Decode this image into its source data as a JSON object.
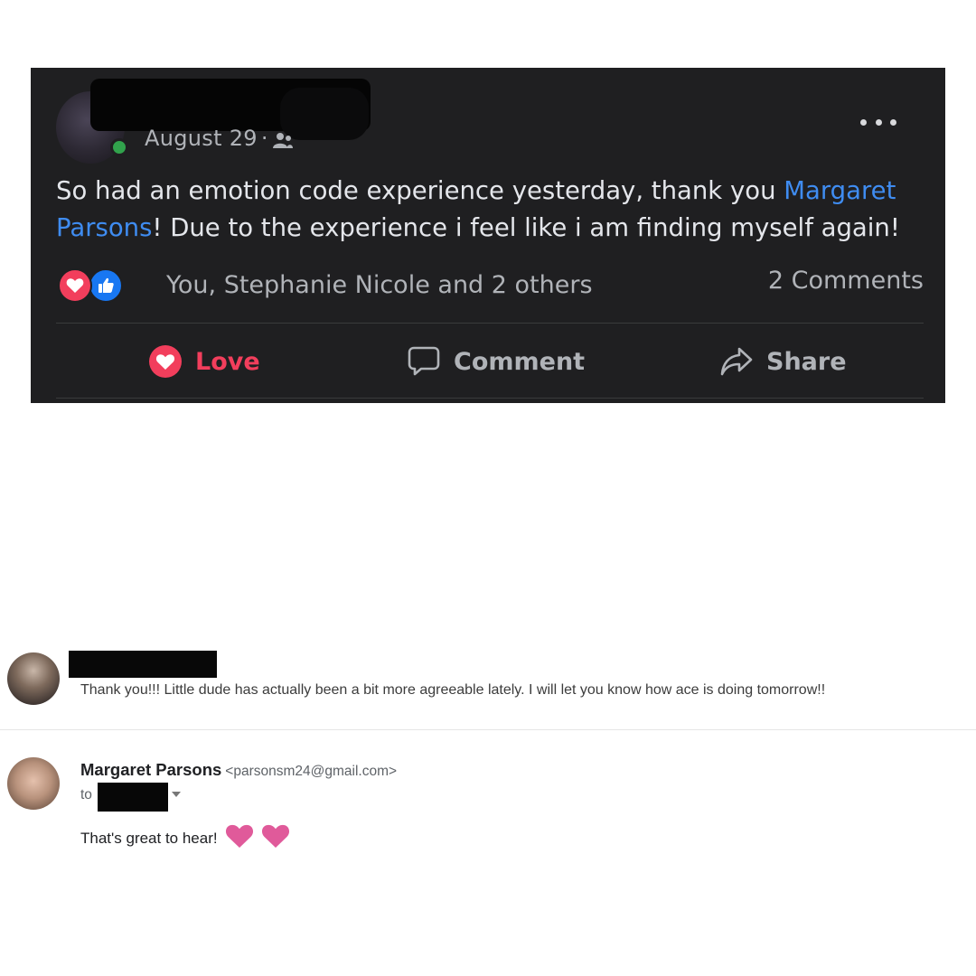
{
  "post": {
    "date": "August 29",
    "separator": "·",
    "body_prefix": "So had an emotion code experience yesterday, thank you ",
    "mention": "Margaret Parsons",
    "body_suffix": "! Due to the experience i feel like i am finding myself again!",
    "reactions_text": "You, Stephanie Nicole and 2 others",
    "comments_count": "2 Comments",
    "actions": {
      "love": "Love",
      "comment": "Comment",
      "share": "Share"
    },
    "icons": [
      "more-options-icon",
      "audience-friends-icon",
      "love-reaction-icon",
      "like-reaction-icon",
      "comment-icon",
      "share-icon"
    ],
    "colors": {
      "background": "#1f1f21",
      "link": "#3f8cf1",
      "love": "#f23e5c",
      "like": "#1877f2",
      "online": "#31a24c"
    }
  },
  "email": {
    "reply": {
      "snippet": "Thank you!!! Little dude has actually been a bit more agreeable lately. I will let you know how ace is doing tomorrow!!"
    },
    "message": {
      "sender_name": "Margaret Parsons",
      "sender_email": "<parsonsm24@gmail.com>",
      "to_label": "to",
      "body": "That's great to hear!",
      "heart_color": "#e05a9a"
    }
  }
}
